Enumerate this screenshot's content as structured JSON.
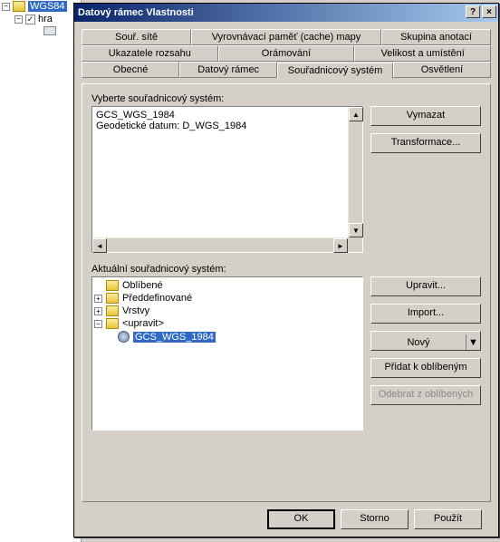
{
  "bgTree": {
    "root": {
      "label": "WGS84",
      "expanded": "−"
    },
    "child": {
      "label": "hra",
      "checked": "✓"
    }
  },
  "dialog": {
    "title": "Datový rámec Vlastnosti",
    "help": "?",
    "close": "×"
  },
  "tabs": {
    "row1": [
      "Souř. sítě",
      "Vyrovnávací paměť (cache) mapy",
      "Skupina anotací"
    ],
    "row2": [
      "Ukazatele rozsahu",
      "Orámování",
      "Velikost a umístění"
    ],
    "row3": [
      "Obecné",
      "Datový rámec",
      "Souřadnicový systém",
      "Osvětlení"
    ],
    "activeIndex": 2
  },
  "coordSys": {
    "selectLabel": "Vyberte souřadnicový systém:",
    "line1": "GCS_WGS_1984",
    "line2": "Geodetické datum: D_WGS_1984",
    "currentLabel": "Aktuální souřadnicový systém:"
  },
  "tree": {
    "n0": {
      "label": "Oblíbené",
      "exp": ""
    },
    "n1": {
      "label": "Předdefinované",
      "exp": "+"
    },
    "n2": {
      "label": "Vrstvy",
      "exp": "+"
    },
    "n3": {
      "label": "<upravit>",
      "exp": "−"
    },
    "n4": {
      "label": "GCS_WGS_1984",
      "selected": true
    }
  },
  "buttons": {
    "clear": "Vymazat",
    "transform": "Transformace...",
    "modify": "Upravit...",
    "import": "Import...",
    "new": "Nový",
    "addFav": "Přidat k oblíbeným",
    "removeFav": "Odebrat z oblíbených",
    "ok": "OK",
    "cancel": "Storno",
    "apply": "Použít"
  }
}
